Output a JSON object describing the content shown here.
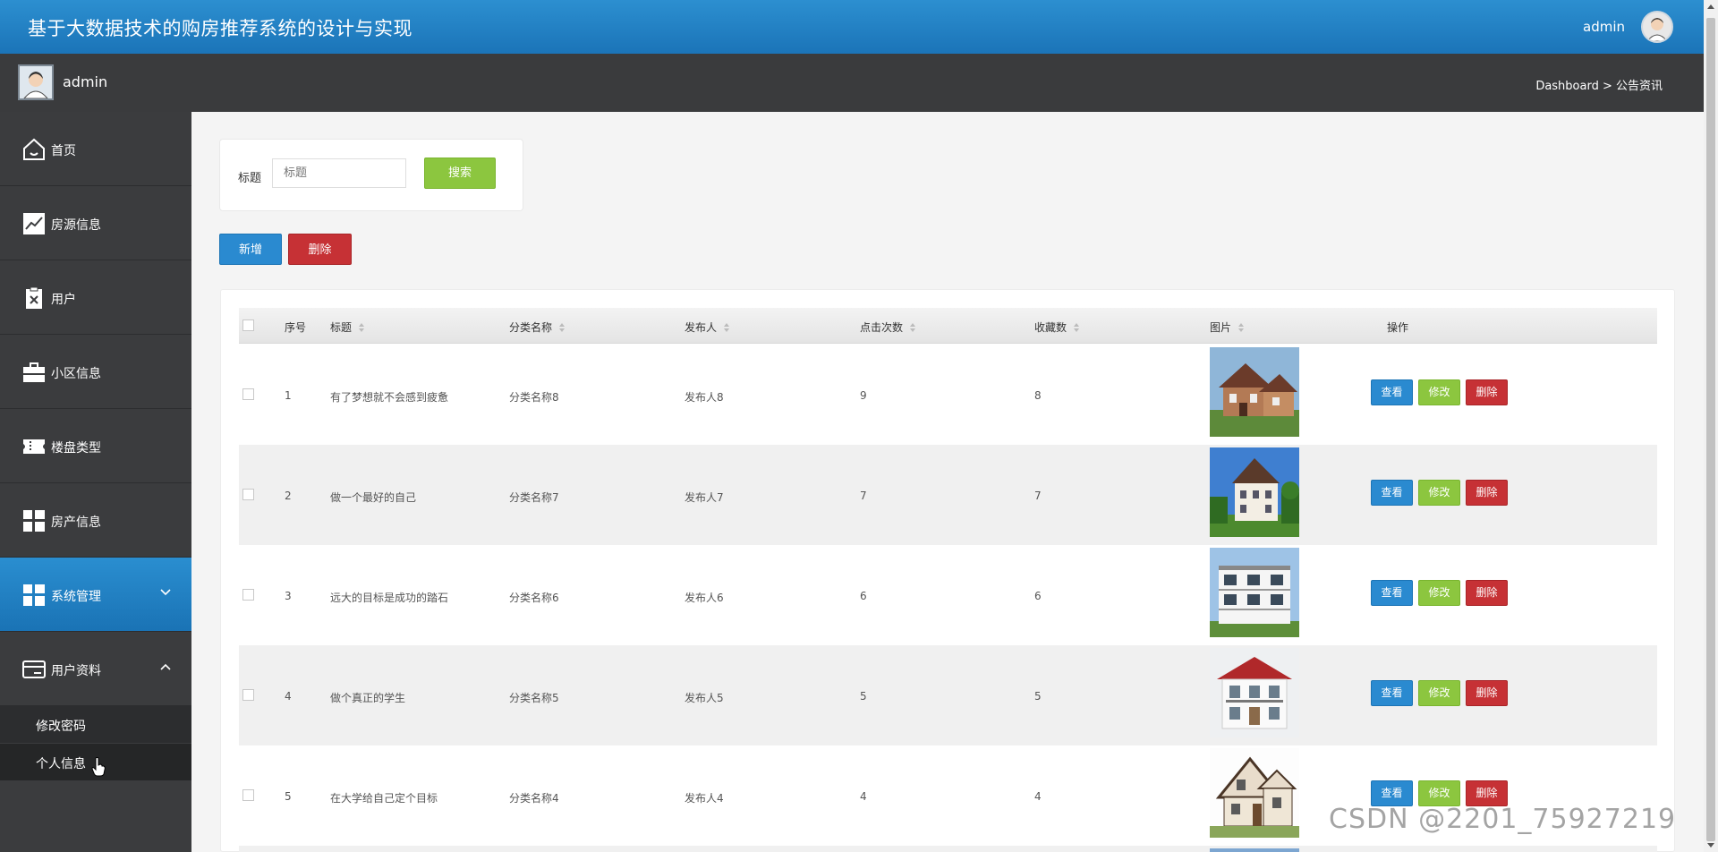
{
  "header": {
    "app_title": "基于大数据技术的购房推荐系统的设计与实现",
    "user": "admin"
  },
  "subbar": {
    "user_name": "admin",
    "breadcrumb": "Dashboard > 公告资讯"
  },
  "sidebar": {
    "items": [
      {
        "label": "首页",
        "icon": "home-icon"
      },
      {
        "label": "房源信息",
        "icon": "chart-line-icon"
      },
      {
        "label": "用户",
        "icon": "clipboard-icon"
      },
      {
        "label": "小区信息",
        "icon": "briefcase-icon"
      },
      {
        "label": "楼盘类型",
        "icon": "ticket-icon"
      },
      {
        "label": "房产信息",
        "icon": "grid-icon"
      },
      {
        "label": "系统管理",
        "icon": "grid-icon",
        "active": true,
        "expander": "chevron-down-icon"
      },
      {
        "label": "用户资料",
        "icon": "card-icon",
        "expander": "chevron-up-icon"
      }
    ],
    "sub_items": [
      {
        "label": "修改密码"
      },
      {
        "label": "个人信息"
      }
    ]
  },
  "search": {
    "label": "标题",
    "placeholder": "标题",
    "button": "搜索"
  },
  "toolbar": {
    "add_label": "新增",
    "delete_label": "删除"
  },
  "table": {
    "headers": [
      "序号",
      "标题",
      "分类名称",
      "发布人",
      "点击次数",
      "收藏数",
      "图片",
      "操作"
    ],
    "rows": [
      {
        "index": "1",
        "title": "有了梦想就不会感到疲惫",
        "category": "分类名称8",
        "publisher": "发布人8",
        "clicks": "9",
        "favorites": "8"
      },
      {
        "index": "2",
        "title": "做一个最好的自己",
        "category": "分类名称7",
        "publisher": "发布人7",
        "clicks": "7",
        "favorites": "7"
      },
      {
        "index": "3",
        "title": "远大的目标是成功的踏石",
        "category": "分类名称6",
        "publisher": "发布人6",
        "clicks": "6",
        "favorites": "6"
      },
      {
        "index": "4",
        "title": "做个真正的学生",
        "category": "分类名称5",
        "publisher": "发布人5",
        "clicks": "5",
        "favorites": "5"
      },
      {
        "index": "5",
        "title": "在大学给自己定个目标",
        "category": "分类名称4",
        "publisher": "发布人4",
        "clicks": "4",
        "favorites": "4"
      }
    ],
    "actions": {
      "view": "查看",
      "edit": "修改",
      "delete": "删除"
    }
  },
  "colors": {
    "primary": "#1b74b8",
    "success": "#8cc63f",
    "danger": "#c63135",
    "sidebar_bg": "#3b3c3e"
  },
  "watermark": "CSDN @2201_75927219"
}
